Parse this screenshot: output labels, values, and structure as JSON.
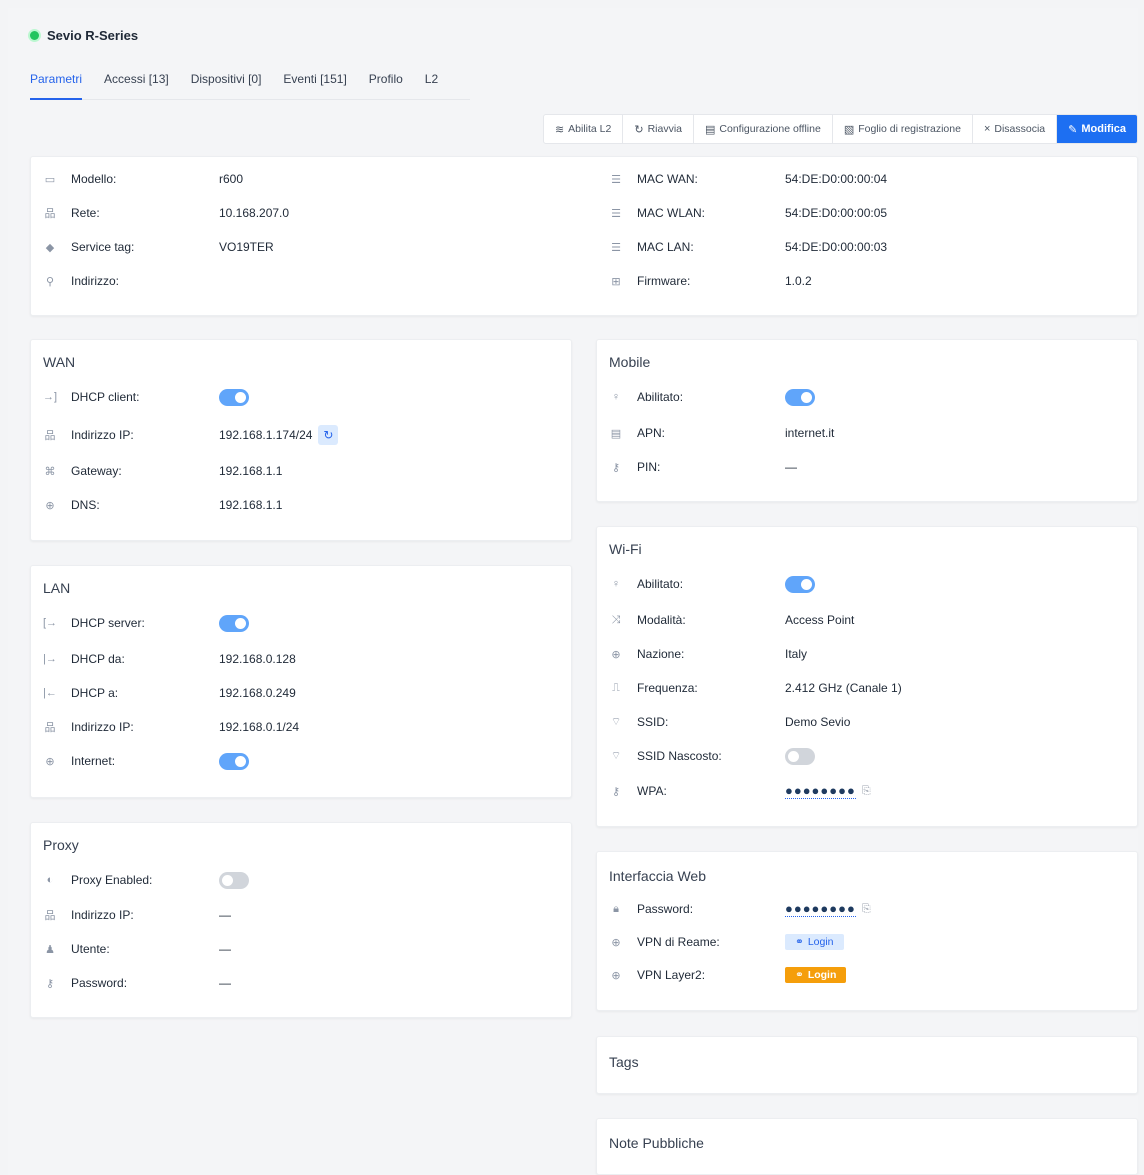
{
  "header": {
    "title": "Sevio R-Series",
    "status_color": "#22c55e"
  },
  "tabs": [
    {
      "label": "Parametri",
      "active": true
    },
    {
      "label": "Accessi [13]"
    },
    {
      "label": "Dispositivi [0]"
    },
    {
      "label": "Eventi [151]"
    },
    {
      "label": "Profilo"
    },
    {
      "label": "L2"
    }
  ],
  "toolbar": {
    "abilita_l2": "Abilita L2",
    "riavvia": "Riavvia",
    "config_offline": "Configurazione offline",
    "foglio": "Foglio di registrazione",
    "disassocia": "Disassocia",
    "modifica": "Modifica"
  },
  "info": {
    "modello": {
      "label": "Modello:",
      "value": "r600"
    },
    "rete": {
      "label": "Rete:",
      "value": "10.168.207.0"
    },
    "service_tag": {
      "label": "Service tag:",
      "value": "VO19TER"
    },
    "indirizzo": {
      "label": "Indirizzo:",
      "value": ""
    },
    "mac_wan": {
      "label": "MAC WAN:",
      "value": "54:DE:D0:00:00:04"
    },
    "mac_wlan": {
      "label": "MAC WLAN:",
      "value": "54:DE:D0:00:00:05"
    },
    "mac_lan": {
      "label": "MAC LAN:",
      "value": "54:DE:D0:00:00:03"
    },
    "firmware": {
      "label": "Firmware:",
      "value": "1.0.2"
    }
  },
  "wan": {
    "title": "WAN",
    "dhcp_client": {
      "label": "DHCP client:",
      "enabled": true
    },
    "ip": {
      "label": "Indirizzo IP:",
      "value": "192.168.1.174/24"
    },
    "gateway": {
      "label": "Gateway:",
      "value": "192.168.1.1"
    },
    "dns": {
      "label": "DNS:",
      "value": "192.168.1.1"
    }
  },
  "lan": {
    "title": "LAN",
    "dhcp_server": {
      "label": "DHCP server:",
      "enabled": true
    },
    "dhcp_da": {
      "label": "DHCP da:",
      "value": "192.168.0.128"
    },
    "dhcp_a": {
      "label": "DHCP a:",
      "value": "192.168.0.249"
    },
    "ip": {
      "label": "Indirizzo IP:",
      "value": "192.168.0.1/24"
    },
    "internet": {
      "label": "Internet:",
      "enabled": true
    }
  },
  "proxy": {
    "title": "Proxy",
    "enabled": {
      "label": "Proxy Enabled:",
      "enabled": false
    },
    "ip": {
      "label": "Indirizzo IP:",
      "value": "—"
    },
    "utente": {
      "label": "Utente:",
      "value": "—"
    },
    "password": {
      "label": "Password:",
      "value": "—"
    }
  },
  "mobile": {
    "title": "Mobile",
    "abilitato": {
      "label": "Abilitato:",
      "enabled": true
    },
    "apn": {
      "label": "APN:",
      "value": "internet.it"
    },
    "pin": {
      "label": "PIN:",
      "value": "—"
    }
  },
  "wifi": {
    "title": "Wi-Fi",
    "abilitato": {
      "label": "Abilitato:",
      "enabled": true
    },
    "modalita": {
      "label": "Modalità:",
      "value": "Access Point"
    },
    "nazione": {
      "label": "Nazione:",
      "value": "Italy"
    },
    "frequenza": {
      "label": "Frequenza:",
      "value": "2.412 GHz (Canale 1)"
    },
    "ssid": {
      "label": "SSID:",
      "value": "Demo Sevio"
    },
    "ssid_nascosto": {
      "label": "SSID Nascosto:",
      "enabled": false
    },
    "wpa": {
      "label": "WPA:",
      "value": "●●●●●●●●"
    }
  },
  "web": {
    "title": "Interfaccia Web",
    "password": {
      "label": "Password:",
      "value": "●●●●●●●●"
    },
    "vpn_reame": {
      "label": "VPN di Reame:",
      "button": "Login"
    },
    "vpn_l2": {
      "label": "VPN Layer2:",
      "button": "Login"
    }
  },
  "tags": {
    "title": "Tags"
  },
  "note": {
    "title": "Note Pubbliche"
  }
}
